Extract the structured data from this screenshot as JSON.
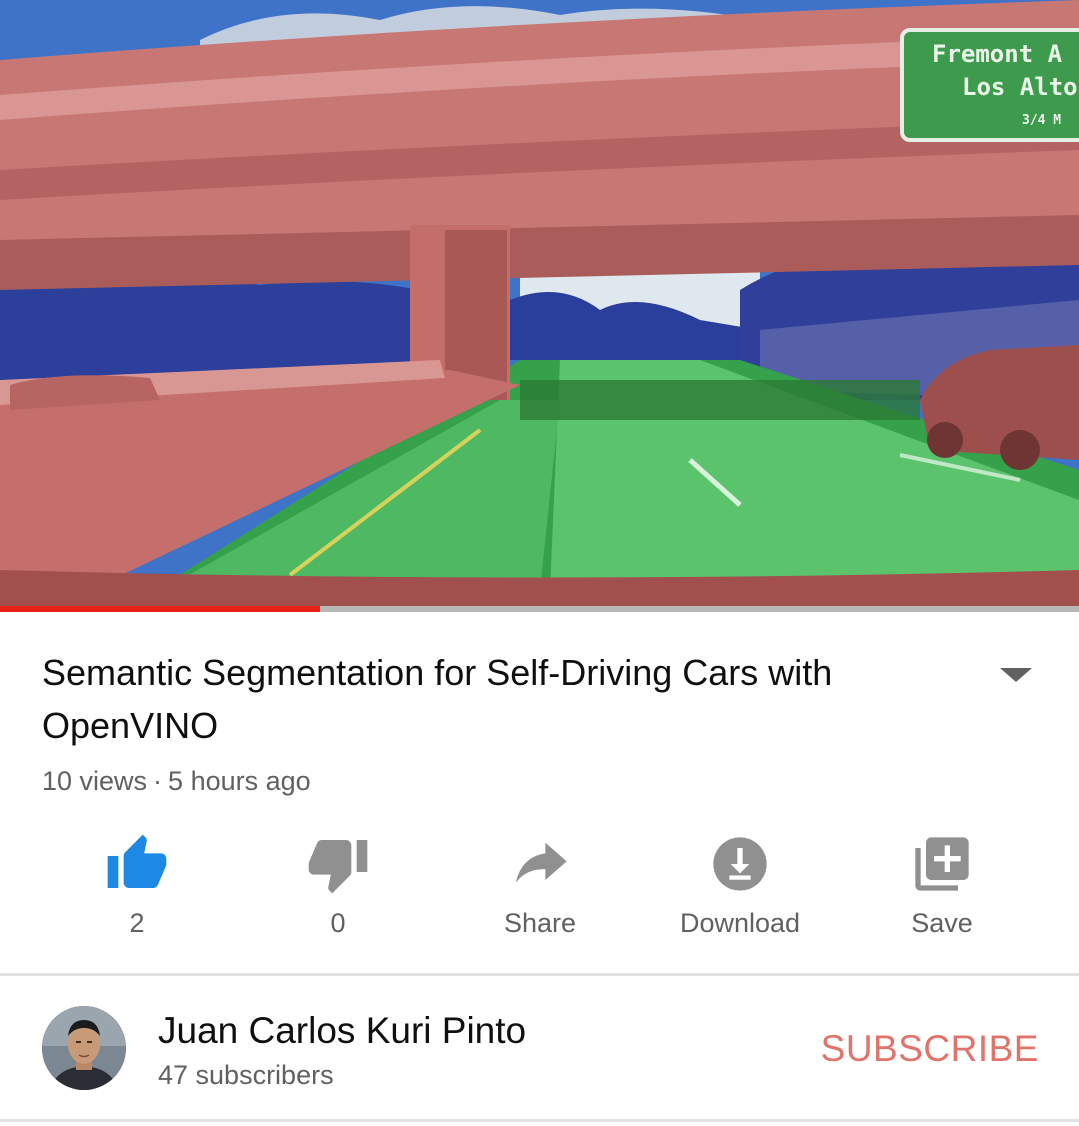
{
  "video": {
    "progress_fraction": 0.297,
    "sign_line1": "Fremont A",
    "sign_line2": "Los Alto",
    "sign_line3": "3/4 M"
  },
  "title": "Semantic Segmentation for Self-Driving Cars with OpenVINO",
  "views": "10 views",
  "separator": "·",
  "age": "5 hours ago",
  "actions": {
    "like_count": "2",
    "dislike_count": "0",
    "share_label": "Share",
    "download_label": "Download",
    "save_label": "Save"
  },
  "channel": {
    "name": "Juan Carlos Kuri Pinto",
    "subscribers": "47 subscribers",
    "subscribe_label": "SUBSCRIBE"
  },
  "colors": {
    "like_active": "#1e88e5",
    "icon_gray": "#909090",
    "progress": "#e62117",
    "subscribe": "#e0736a"
  },
  "icons": [
    "thumbs-up-icon",
    "thumbs-down-icon",
    "share-arrow-icon",
    "download-icon",
    "add-to-playlist-icon",
    "chevron-down-icon"
  ]
}
